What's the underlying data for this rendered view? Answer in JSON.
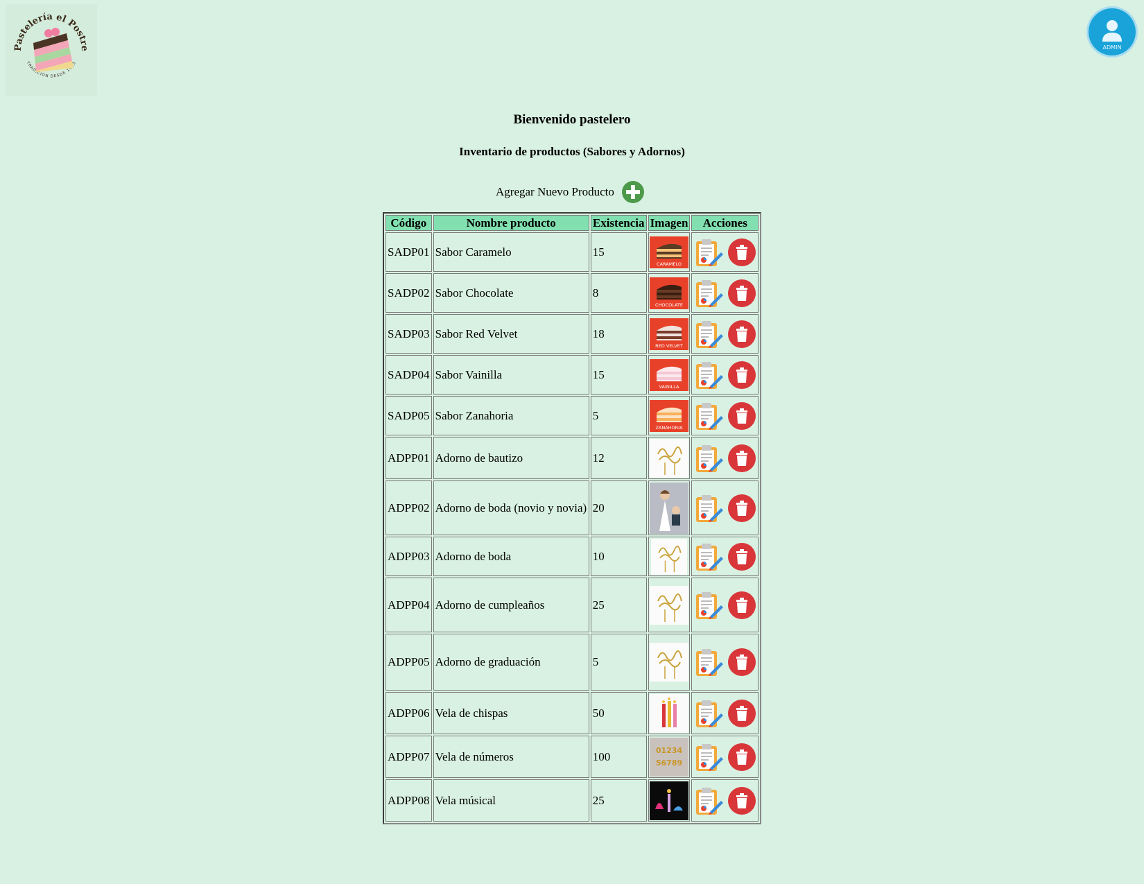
{
  "header": {
    "logo_text": "Pastelería el Postre",
    "logo_tagline": "TRADICIÓN DESDE 1993",
    "user_badge": "ADMIN"
  },
  "page": {
    "title": "Bienvenido pastelero",
    "subtitle": "Inventario de productos (Sabores y Adornos)",
    "add_label": "Agregar Nuevo Producto"
  },
  "table": {
    "headers": [
      "Código",
      "Nombre producto",
      "Existencia",
      "Imagen",
      "Acciones"
    ],
    "rows": [
      {
        "code": "SADP01",
        "name": "Sabor Caramelo",
        "stock": "15",
        "image": "cake-caramelo",
        "image_label": "CARAMELO"
      },
      {
        "code": "SADP02",
        "name": "Sabor Chocolate",
        "stock": "8",
        "image": "cake-chocolate",
        "image_label": "CHOCOLATE"
      },
      {
        "code": "SADP03",
        "name": "Sabor Red Velvet",
        "stock": "18",
        "image": "cake-redvelvet",
        "image_label": "RED VELVET"
      },
      {
        "code": "SADP04",
        "name": "Sabor Vainilla",
        "stock": "15",
        "image": "cake-vainilla",
        "image_label": "VAINILLA"
      },
      {
        "code": "SADP05",
        "name": "Sabor Zanahoria",
        "stock": "5",
        "image": "cake-zanahoria",
        "image_label": "ZANAHORIA"
      },
      {
        "code": "ADPP01",
        "name": "Adorno de bautizo",
        "stock": "12",
        "image": "topper-bautizo"
      },
      {
        "code": "ADPP02",
        "name": "Adorno de boda (novio y novia)",
        "stock": "20",
        "image": "figure-couple"
      },
      {
        "code": "ADPP03",
        "name": "Adorno de boda",
        "stock": "10",
        "image": "topper-boda"
      },
      {
        "code": "ADPP04",
        "name": "Adorno de cumpleaños",
        "stock": "25",
        "image": "topper-cumple"
      },
      {
        "code": "ADPP05",
        "name": "Adorno de graduación",
        "stock": "5",
        "image": "topper-graduacion"
      },
      {
        "code": "ADPP06",
        "name": "Vela de chispas",
        "stock": "50",
        "image": "candles-sparkle"
      },
      {
        "code": "ADPP07",
        "name": "Vela de números",
        "stock": "100",
        "image": "candles-numbers"
      },
      {
        "code": "ADPP08",
        "name": "Vela músical",
        "stock": "25",
        "image": "candle-musical"
      }
    ]
  },
  "colors": {
    "background": "#d9f1e2",
    "header_cell": "#82e0b0",
    "add_icon": "#4c9a4a",
    "delete_icon": "#d9363a",
    "avatar": "#1aa3d9",
    "cake_tile": "#e8412a"
  }
}
